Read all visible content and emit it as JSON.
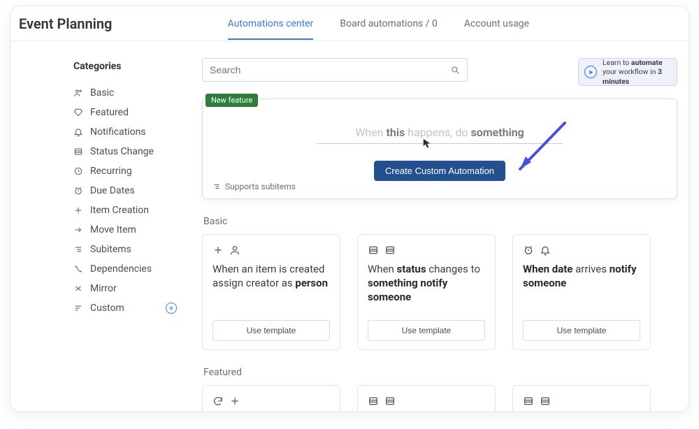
{
  "header": {
    "title": "Event Planning",
    "tabs": [
      {
        "label": "Automations center",
        "active": true
      },
      {
        "label": "Board automations / 0",
        "active": false
      },
      {
        "label": "Account usage",
        "active": false
      }
    ]
  },
  "search": {
    "placeholder": "Search"
  },
  "learn": {
    "pre": "Learn to ",
    "bold1": "automate",
    "mid": " your workflow in ",
    "bold2": "3 minutes"
  },
  "sidebar": {
    "heading": "Categories",
    "items": [
      {
        "label": "Basic",
        "icon": "person-icon"
      },
      {
        "label": "Featured",
        "icon": "diamond-icon"
      },
      {
        "label": "Notifications",
        "icon": "bell-icon"
      },
      {
        "label": "Status Change",
        "icon": "list-icon"
      },
      {
        "label": "Recurring",
        "icon": "recur-icon"
      },
      {
        "label": "Due Dates",
        "icon": "alarm-icon"
      },
      {
        "label": "Item Creation",
        "icon": "plus-icon"
      },
      {
        "label": "Move Item",
        "icon": "arrow-right-icon"
      },
      {
        "label": "Subitems",
        "icon": "subitems-icon"
      },
      {
        "label": "Dependencies",
        "icon": "dependencies-icon"
      },
      {
        "label": "Mirror",
        "icon": "mirror-icon"
      },
      {
        "label": "Custom",
        "icon": "custom-icon",
        "add": true
      }
    ]
  },
  "hero": {
    "badge": "New feature",
    "line_pre": "When ",
    "line_this": "this",
    "line_mid": " happens, do ",
    "line_something": "something",
    "button": "Create Custom Automation",
    "subnote": "Supports subitems"
  },
  "sections": {
    "basic": {
      "heading": "Basic",
      "cards": [
        {
          "icons": [
            "plus-icon",
            "person-icon"
          ],
          "parts": [
            "When an item is created assign creator as ",
            "person"
          ],
          "bold_idx": [
            1
          ],
          "button": "Use template"
        },
        {
          "icons": [
            "list-icon",
            "list-icon"
          ],
          "parts": [
            "When ",
            "status",
            " changes to ",
            "something notify someone"
          ],
          "bold_idx": [
            1,
            3
          ],
          "button": "Use template"
        },
        {
          "icons": [
            "alarm-icon",
            "bell-icon"
          ],
          "parts": [
            "When date",
            " arrives ",
            "notify someone"
          ],
          "bold_idx": [
            0,
            2
          ],
          "button": "Use template"
        }
      ]
    },
    "featured": {
      "heading": "Featured",
      "cards": [
        {
          "icons": [
            "refresh-icon",
            "plus-icon"
          ]
        },
        {
          "icons": [
            "list-icon",
            "list-icon"
          ]
        },
        {
          "icons": [
            "list-icon",
            "list-icon"
          ]
        }
      ]
    }
  }
}
